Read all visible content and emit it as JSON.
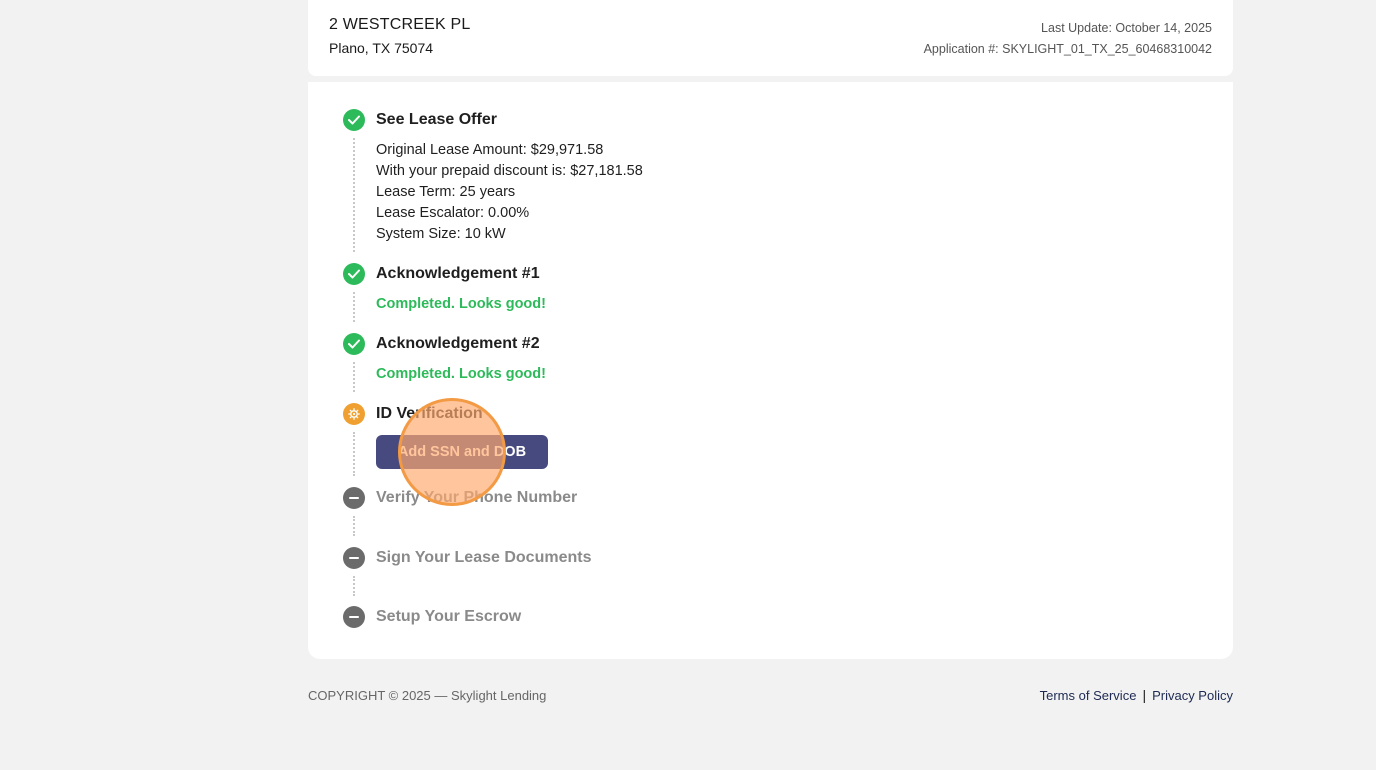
{
  "header": {
    "address_line1": "2 WESTCREEK PL",
    "address_line2": "Plano, TX 75074",
    "last_update": "Last Update: October 14, 2025",
    "application_number": "Application #: SKYLIGHT_01_TX_25_60468310042"
  },
  "steps": [
    {
      "title": "See Lease Offer",
      "status": "completed",
      "details": [
        "Original Lease Amount: $29,971.58",
        "With your prepaid discount is: $27,181.58",
        "Lease Term: 25 years",
        "Lease Escalator: 0.00%",
        "System Size: 10 kW"
      ]
    },
    {
      "title": "Acknowledgement #1",
      "status": "completed",
      "message": "Completed. Looks good!"
    },
    {
      "title": "Acknowledgement #2",
      "status": "completed",
      "message": "Completed. Looks good!"
    },
    {
      "title": "ID Verification",
      "status": "in-progress",
      "button_label": "Add SSN and DOB"
    },
    {
      "title": "Verify Your Phone Number",
      "status": "pending"
    },
    {
      "title": "Sign Your Lease Documents",
      "status": "pending"
    },
    {
      "title": "Setup Your Escrow",
      "status": "pending"
    }
  ],
  "icons": {
    "completed": "check-circle-icon",
    "in-progress": "gear-icon",
    "pending": "minus-circle-icon"
  },
  "colors": {
    "success": "#2dba5a",
    "in_progress": "#f0a030",
    "pending": "#6b6b6b",
    "primary_button": "#474a7e",
    "link": "#1e2a52"
  },
  "footer": {
    "copyright": "COPYRIGHT © 2025 — Skylight Lending",
    "terms_label": "Terms of Service",
    "separator": "|",
    "privacy_label": "Privacy Policy"
  }
}
